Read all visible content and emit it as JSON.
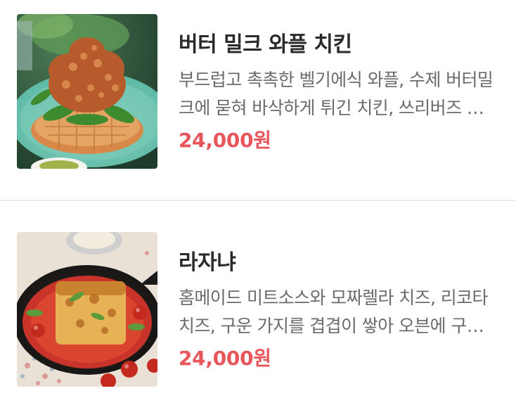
{
  "menu": {
    "items": [
      {
        "title": "버터 밀크 와플 치킨",
        "description": "부드럽고 촉촉한 벨기에식 와플, 수제 버터밀크에 묻혀 바삭하게 튀긴 치킨, 쓰리버즈 …",
        "price": "24,000원",
        "image_icon": "waffle-chicken-photo"
      },
      {
        "title": "라자냐",
        "description": "홈메이드 미트소스와 모짜렐라 치즈, 리코타 치즈, 구운 가지를 겹겹이 쌓아 오븐에 구…",
        "price": "24,000원",
        "image_icon": "lasagna-photo"
      }
    ]
  },
  "colors": {
    "price": "#e8555a",
    "title": "#2a2a2a",
    "description": "#6b6b6b",
    "divider": "#ececec"
  }
}
